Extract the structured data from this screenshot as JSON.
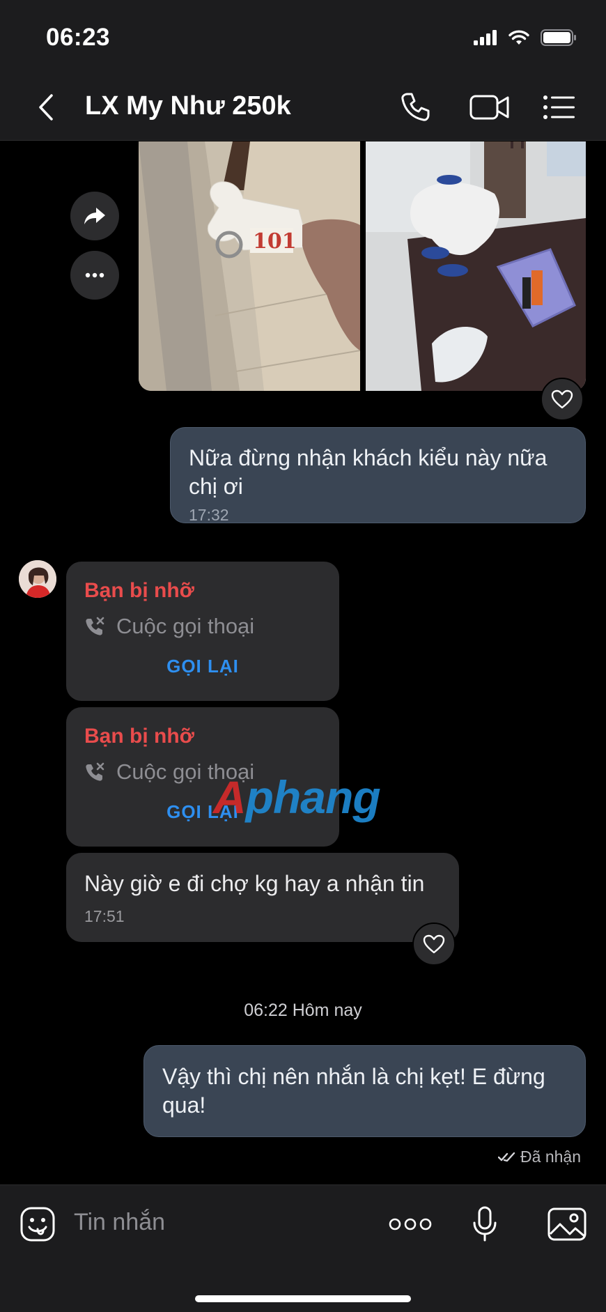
{
  "status_bar": {
    "time": "06:23"
  },
  "header": {
    "title": "LX My Như 250k",
    "back_icon": "chevron-left-icon",
    "call_icon": "phone-icon",
    "video_icon": "video-camera-icon",
    "menu_icon": "list-icon"
  },
  "messages": [
    {
      "type": "photos",
      "direction": "outgoing",
      "photos": [
        "room-key-photo",
        "room-interior-photo"
      ]
    },
    {
      "type": "text",
      "direction": "outgoing",
      "text": "Nữa đừng nhận khách kiểu này nữa chị ơi",
      "time": "17:32"
    },
    {
      "type": "missed_call",
      "direction": "incoming",
      "title": "Bạn bị nhỡ",
      "label": "Cuộc gọi thoại",
      "action": "GỌI LẠI"
    },
    {
      "type": "missed_call",
      "direction": "incoming",
      "title": "Bạn bị nhỡ",
      "label": "Cuộc gọi thoại",
      "action": "GỌI LẠI"
    },
    {
      "type": "text",
      "direction": "incoming",
      "text": "Này giờ e đi chợ kg hay a nhận tin",
      "time": "17:51"
    },
    {
      "type": "date_separator",
      "text": "06:22 Hôm nay"
    },
    {
      "type": "text",
      "direction": "outgoing",
      "text": "Vậy thì chị nên nhắn là chị kẹt! E đừng qua!",
      "status": "Đã nhận"
    }
  ],
  "watermark": {
    "first": "A",
    "rest": "phang"
  },
  "input_bar": {
    "placeholder": "Tin nhắn"
  },
  "colors": {
    "background": "#000000",
    "bar": "#1c1c1e",
    "outgoing_bubble": "#3a4554",
    "incoming_bubble": "#2c2c2e",
    "missed_red": "#e94c4c",
    "callback_blue": "#2e8ff0"
  }
}
